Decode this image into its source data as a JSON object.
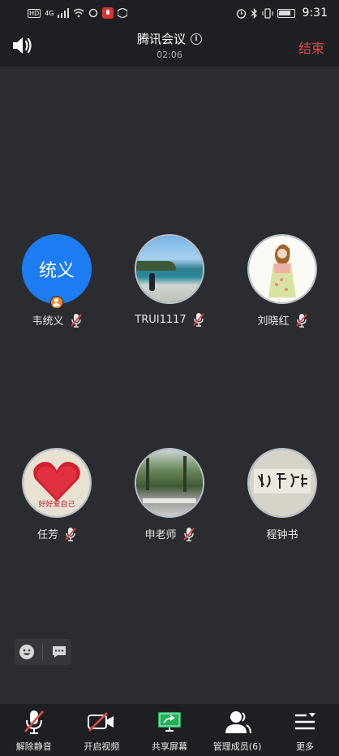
{
  "status_bar": {
    "hd_label": "HD",
    "network_label": "4G",
    "time": "9:31"
  },
  "header": {
    "title": "腾讯会议",
    "timer": "02:06",
    "end_label": "结束"
  },
  "participants": [
    {
      "name": "韦统义",
      "avatar_text": "统义",
      "avatar_type": "text",
      "is_host": true,
      "mic": "muted"
    },
    {
      "name": "TRUI1117",
      "avatar_type": "photo-beach",
      "mic": "muted"
    },
    {
      "name": "刘晓红",
      "avatar_type": "photo-illustration",
      "mic": "muted"
    },
    {
      "name": "任芳",
      "avatar_type": "photo-heart",
      "avatar_overlay_text": "好好爱自己",
      "mic": "muted"
    },
    {
      "name": "申老师",
      "avatar_type": "photo-garden",
      "mic": "muted"
    },
    {
      "name": "程钟书",
      "avatar_type": "photo-calligraphy",
      "mic": "none"
    }
  ],
  "toolbar": {
    "unmute_label": "解除静音",
    "video_label": "开启视频",
    "share_label": "共享屏幕",
    "members_label": "管理成员(6)",
    "more_label": "更多"
  },
  "colors": {
    "background": "#2b2c30",
    "bar": "#1e1f22",
    "end_red": "#e24a4a",
    "avatar_blue": "#1e7cf2",
    "share_green": "#1fb05a",
    "mute_red": "#e24a4a"
  }
}
